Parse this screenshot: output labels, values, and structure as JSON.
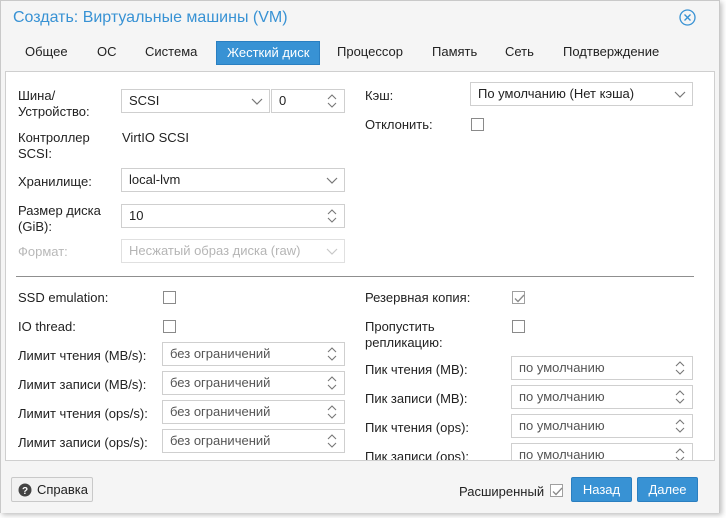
{
  "window": {
    "title": "Создать: Виртуальные машины (VM)"
  },
  "tabs": [
    "Общее",
    "ОС",
    "Система",
    "Жесткий диск",
    "Процессор",
    "Память",
    "Сеть",
    "Подтверждение"
  ],
  "active_tab": "Жесткий диск",
  "disk": {
    "bus_label_1": "Шина/",
    "bus_label_2": "Устройство:",
    "bus_value": "SCSI",
    "device_value": "0",
    "controller_label_1": "Контроллер",
    "controller_label_2": "SCSI:",
    "controller_value": "VirtIO SCSI",
    "storage_label": "Хранилище:",
    "storage_value": "local-lvm",
    "size_label_1": "Размер диска",
    "size_label_2": "(GiB):",
    "size_value": "10",
    "format_label": "Формат:",
    "format_value": "Несжатый образ диска (raw)",
    "cache_label": "Кэш:",
    "cache_value": "По умолчанию (Нет кэша)",
    "discard_label": "Отклонить:",
    "discard_checked": false
  },
  "advanced": {
    "ssd_label": "SSD emulation:",
    "ssd_checked": false,
    "iothread_label": "IO thread:",
    "iothread_checked": false,
    "read_limit_mb_label": "Лимит чтения (MB/s):",
    "write_limit_mb_label": "Лимит записи (MB/s):",
    "read_limit_ops_label": "Лимит чтения (ops/s):",
    "write_limit_ops_label": "Лимит записи (ops/s):",
    "no_limit_placeholder": "без ограничений",
    "backup_label": "Резервная копия:",
    "backup_checked": true,
    "skip_repl_label_1": "Пропустить",
    "skip_repl_label_2": "репликацию:",
    "skip_repl_checked": false,
    "read_burst_mb_label": "Пик чтения (MB):",
    "write_burst_mb_label": "Пик записи (MB):",
    "read_burst_ops_label": "Пик чтения (ops):",
    "write_burst_ops_label": "Пик записи (ops):",
    "default_placeholder": "по умолчанию"
  },
  "footer": {
    "help_label": "Справка",
    "advanced_label": "Расширенный",
    "advanced_checked": true,
    "back_label": "Назад",
    "next_label": "Далее"
  },
  "colors": {
    "accent": "#3892d4",
    "panel_bg": "#ffffff",
    "dialog_bg": "#f5f5f5"
  }
}
